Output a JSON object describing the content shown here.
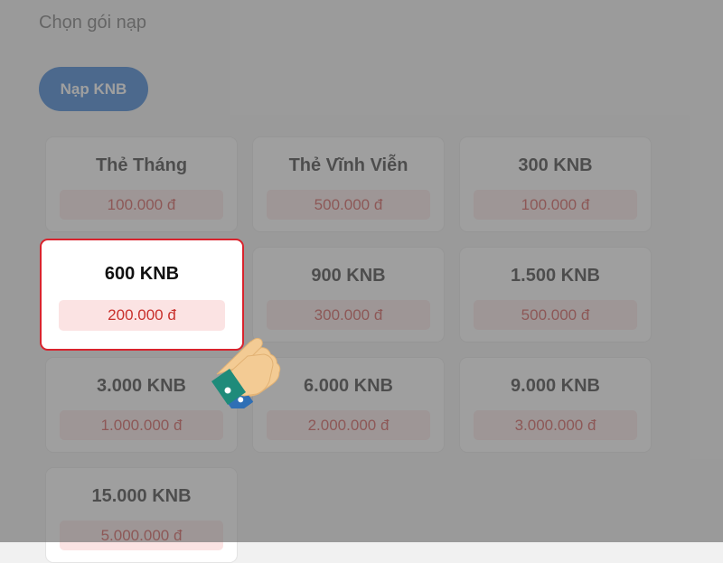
{
  "section_title": "Chọn gói nạp",
  "tab": {
    "label": "Nạp KNB"
  },
  "packages": [
    {
      "name": "Thẻ Tháng",
      "price": "100.000 đ"
    },
    {
      "name": "Thẻ Vĩnh Viễn",
      "price": "500.000 đ"
    },
    {
      "name": "300 KNB",
      "price": "100.000 đ"
    },
    {
      "name": "600 KNB",
      "price": "200.000 đ",
      "selected": true
    },
    {
      "name": "900 KNB",
      "price": "300.000 đ"
    },
    {
      "name": "1.500 KNB",
      "price": "500.000 đ"
    },
    {
      "name": "3.000 KNB",
      "price": "1.000.000 đ"
    },
    {
      "name": "6.000 KNB",
      "price": "2.000.000 đ"
    },
    {
      "name": "9.000 KNB",
      "price": "3.000.000 đ"
    },
    {
      "name": "15.000 KNB",
      "price": "5.000.000 đ"
    }
  ],
  "colors": {
    "accent": "#0d62c9",
    "price_text": "#c9302c",
    "price_bg": "#fbe3e3",
    "selected_border": "#d9232d"
  },
  "icons": {
    "pointer": "pointing-hand-icon"
  }
}
